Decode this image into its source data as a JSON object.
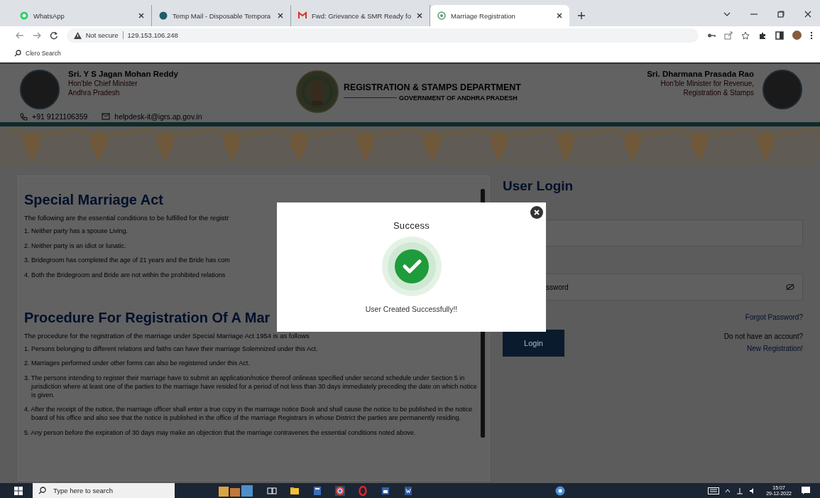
{
  "browser": {
    "tabs": [
      {
        "title": "WhatsApp",
        "kind": "chat",
        "selected": false
      },
      {
        "title": "Temp Mail - Disposable Tempora",
        "kind": "circle",
        "selected": false
      },
      {
        "title": "Fwd: Grievance & SMR Ready fo",
        "kind": "mail",
        "selected": false
      },
      {
        "title": "Marriage Registration",
        "kind": "globe",
        "selected": true
      }
    ],
    "security": "Not secure",
    "url": "129.153.106.248",
    "bookmarks": [
      "Clero Search"
    ]
  },
  "header": {
    "left_person": {
      "name": "Sri. Y S Jagan Mohan Reddy",
      "lines": [
        "Hon'ble Chief Minister",
        "Andhra Pradesh"
      ]
    },
    "phone": "+91 9121106359",
    "email": "helpdesk-it@igrs.ap.gov.in",
    "department": {
      "title": "REGISTRATION & STAMPS DEPARTMENT",
      "subtitle": "GOVERNMENT OF ANDHRA PRADESH"
    },
    "right_person": {
      "name": "Sri. Dharmana Prasada Rao",
      "lines": [
        "Hon'ble Minister for Revenue,",
        "Registration & Stamps"
      ]
    }
  },
  "info": [
    {
      "heading": "Special Marriage Act",
      "intro": "The following are the essential conditions to be fulfilled for the registr",
      "items": [
        "1. Neither party has a spouse Living.",
        "2. Neither party is an idiot or lunatic.",
        "3. Bridegroom has completed the age of 21 years and the Bride has com",
        "4. Both the Bridegroom and Bride are not within the prohibited relations"
      ]
    },
    {
      "heading": "Procedure For Registration Of A Mar",
      "intro": "The procedure for the registration of the marriage under Special Marriage Act 1954 is as follows",
      "items": [
        "1. Persons belonging to different relations and faiths can have their marriage Solemnized under this Act.",
        "2. Marriages performed under other forms can also be registered under this Act.",
        "3. The persons intending to register their marriage have to submit an application/notice thereof onlineas specified under second schedule under Section 5 in jurisdiction where at least one of the parties to the marriage have resided for a period of not less than 30 days immediately preceding the date on which notice is given.",
        "4. After the receipt of the notice, the marriage officer shall enter a true copy in the marriage notice Book and shall cause the notice to be published in the notice board of his office and also see that the notice is published in the office of the marriage Registrars in whose District the parties are permanently residing.",
        "5. Any person before the expiration of 30 days may make an objection that the marriage contravenes the essential conditions noted above."
      ]
    }
  ],
  "login": {
    "title": "User Login",
    "password_placeholder": "ssword",
    "forgot": "Forgot Password?",
    "button": "Login",
    "no_account": "Do not have an account?",
    "register": "New Registration!"
  },
  "modal": {
    "title": "Success",
    "message": "User Created Successfully!!"
  },
  "taskbar": {
    "search_placeholder": "Type here to search",
    "time": "15:07",
    "date": "29-12-2022"
  }
}
